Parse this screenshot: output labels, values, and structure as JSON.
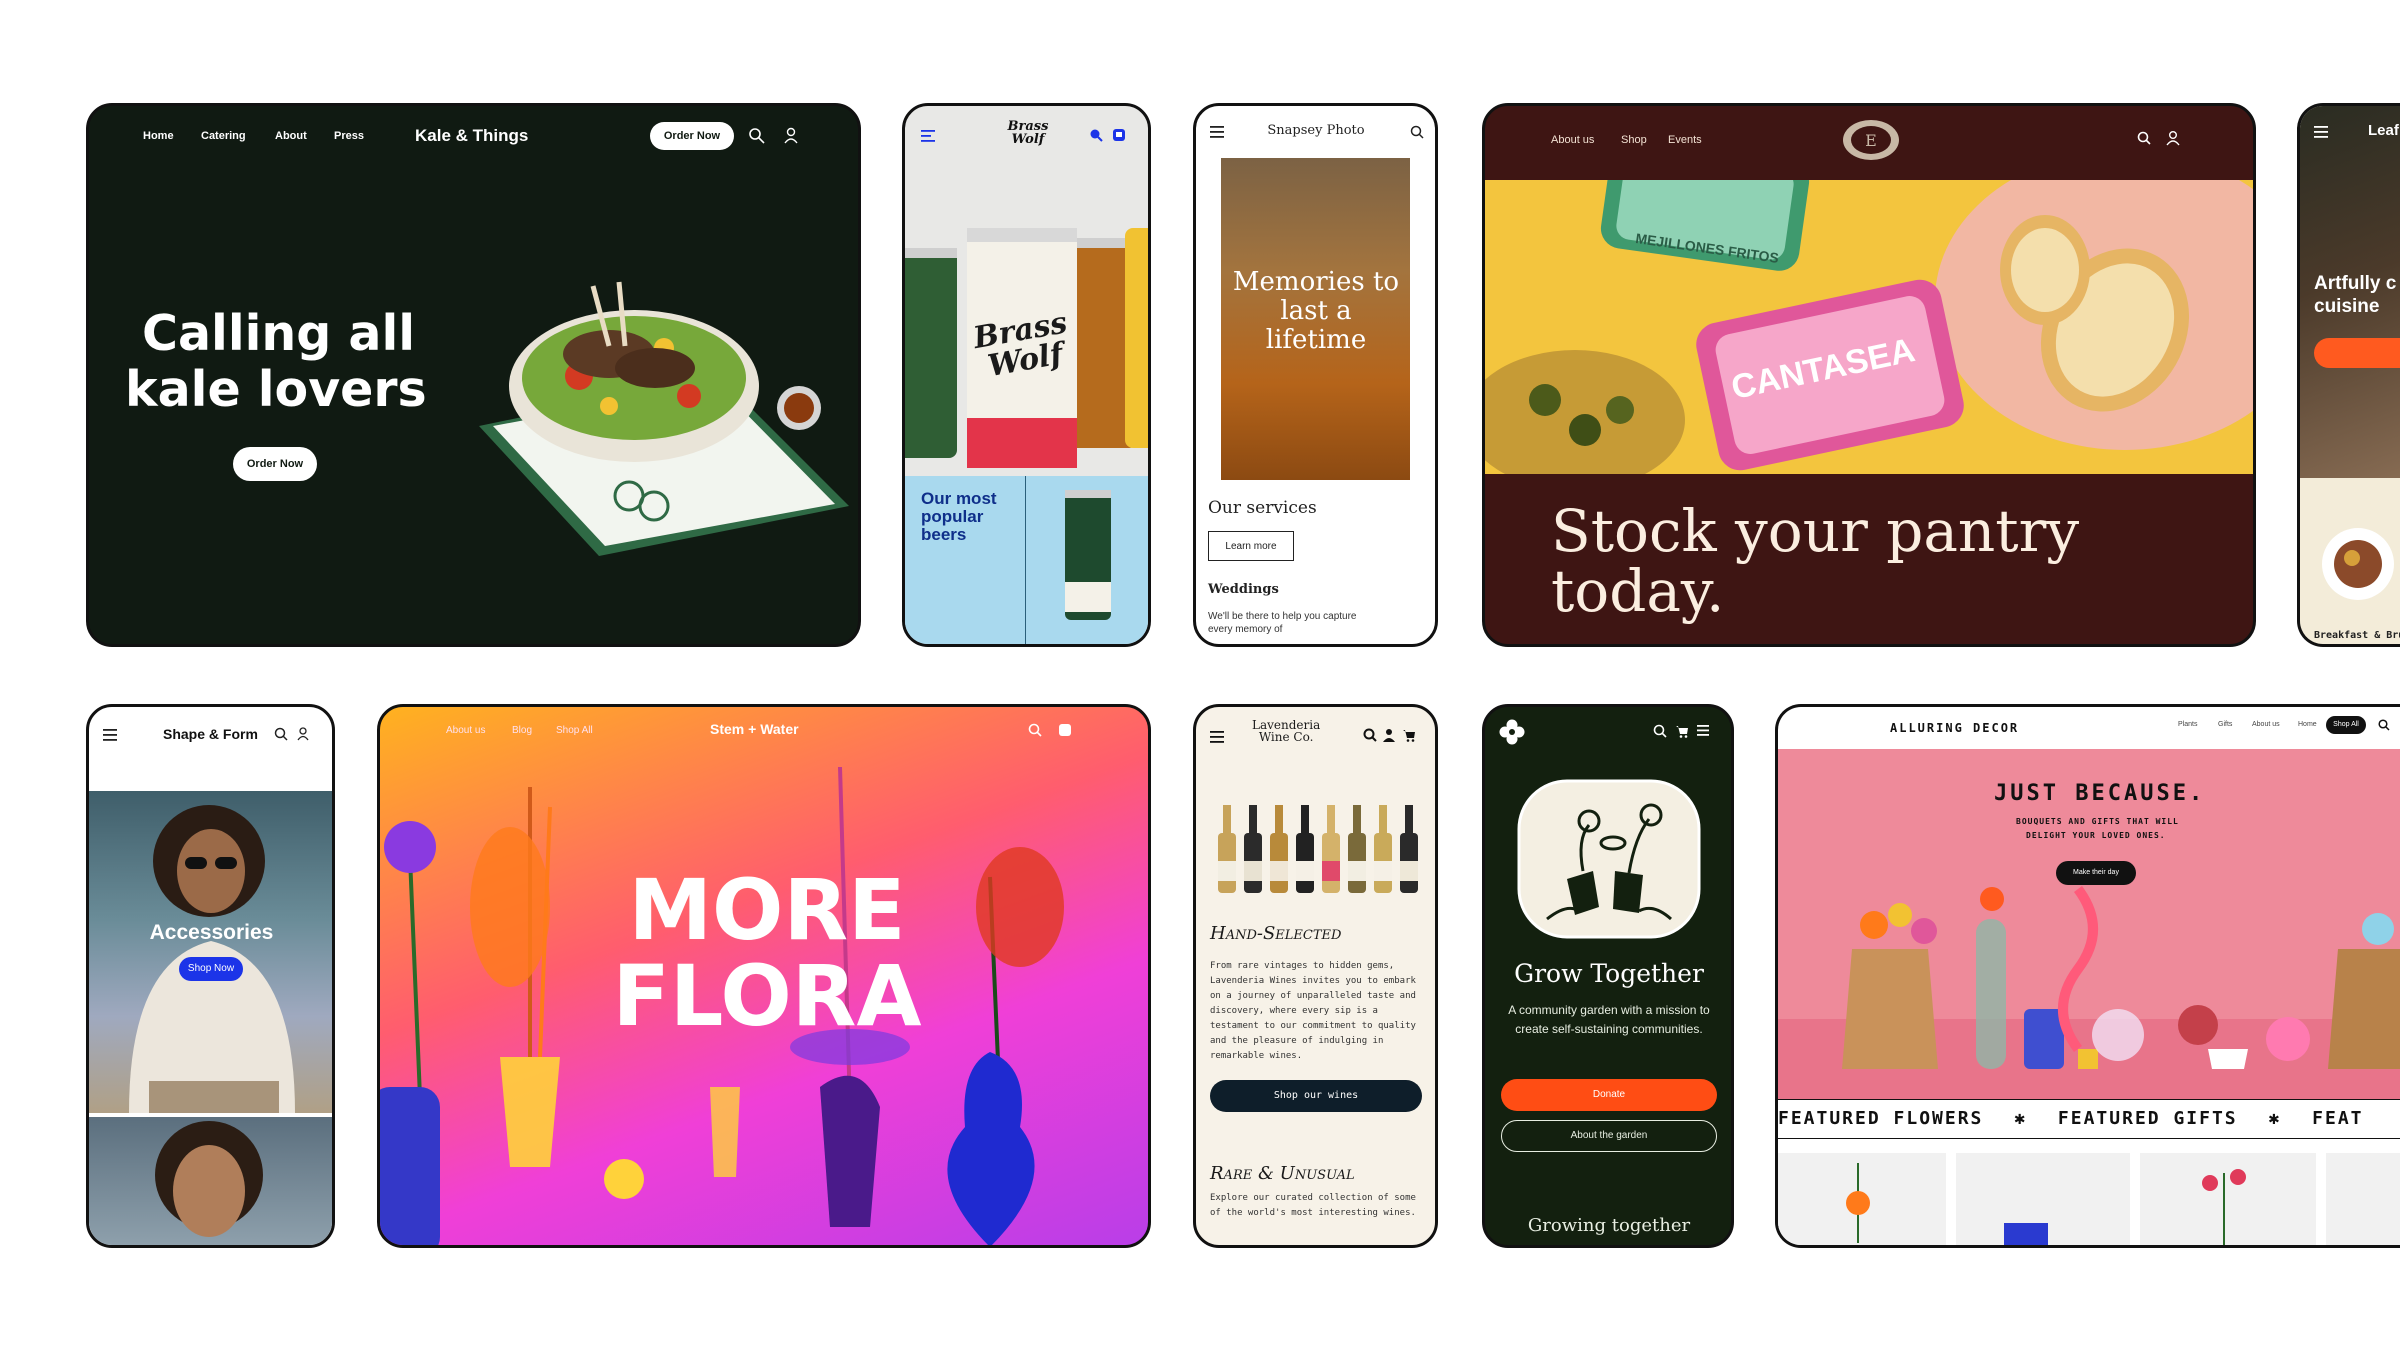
{
  "colors": {
    "kale_bg": "#101a12",
    "stock_bg": "#3e1513",
    "garden_bg": "#13200f",
    "lavenderia_bg": "#f7f2e8",
    "flora_pink": "#ff3fa0",
    "donate_orange": "#ff4d14",
    "beer_blue": "#a9d9ee",
    "shop_blue": "#1c34e8"
  },
  "kale": {
    "nav": [
      "Home",
      "Catering",
      "About",
      "Press"
    ],
    "brand": "Kale & Things",
    "order_button": "Order Now",
    "headline_1": "Calling all",
    "headline_2": "kale lovers",
    "cta": "Order Now",
    "icons": [
      "search-icon",
      "user-icon"
    ]
  },
  "brasswolf": {
    "logo": "Brass Wolf",
    "can_text": "Brass Wolf",
    "heading": "Our most popular beers",
    "icons": [
      "menu-icon",
      "search-icon",
      "cart-icon"
    ]
  },
  "snapsey": {
    "brand": "Snapsey Photo",
    "hero_text": "Memories to last a lifetime",
    "services_title": "Our services",
    "learn_more": "Learn more",
    "weddings_title": "Weddings",
    "weddings_text": "We'll be there to help you capture every memory of"
  },
  "pantry": {
    "nav": [
      "About us",
      "Shop",
      "Events"
    ],
    "headline_1": "Stock your pantry",
    "headline_2": "today.",
    "tin_1": "MEJILLONES FRITOS",
    "tin_2": "CANTASEA",
    "icons": [
      "search-icon",
      "user-icon"
    ]
  },
  "leaf": {
    "brand": "Leaf",
    "hero_1": "Artfully c",
    "hero_2": "cuisine",
    "footer": "Breakfast & Bru"
  },
  "shapeform": {
    "brand": "Shape & Form",
    "hero": "Accessories",
    "cta": "Shop Now"
  },
  "stemwater": {
    "nav": [
      "About us",
      "Blog",
      "Shop All"
    ],
    "brand": "Stem + Water",
    "headline_1": "MORE",
    "headline_2": "FLORA"
  },
  "lavenderia": {
    "logo_1": "Lavenderia",
    "logo_2": "Wine Co.",
    "section_title": "Hand-Selected",
    "body": "From rare vintages to hidden gems, Lavenderia Wines invites you to embark on a journey of unparalleled taste and discovery, where every sip is a testament to our commitment to quality and the pleasure of indulging in remarkable wines.",
    "cta": "Shop our wines",
    "section2_title": "Rare & Unusual",
    "section2_text": "Explore our curated collection of some of the world's most interesting wines."
  },
  "garden": {
    "title": "Grow Together",
    "body": "A community garden with a mission to create self-sustaining communities.",
    "donate": "Donate",
    "about": "About the garden",
    "footer": "Growing together"
  },
  "alluring": {
    "brand": "ALLURING DECOR",
    "nav": [
      "Plants",
      "Gifts",
      "About us",
      "Home"
    ],
    "nav_cta": "Shop All",
    "headline": "JUST BECAUSE.",
    "sub_1": "BOUQUETS AND GIFTS THAT WILL",
    "sub_2": "DELIGHT YOUR LOVED ONES.",
    "cta": "Make their day",
    "ticker": [
      "FEATURED FLOWERS",
      "FEATURED GIFTS",
      "FEAT"
    ],
    "ticker_sep": "✱"
  }
}
